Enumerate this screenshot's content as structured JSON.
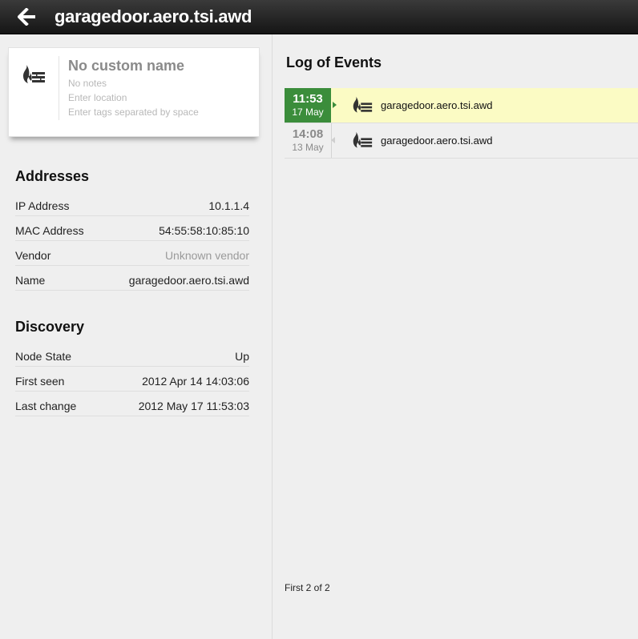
{
  "header": {
    "title": "garagedoor.aero.tsi.awd",
    "back_icon": "arrow-left-icon"
  },
  "node_card": {
    "icon": "firewall-icon",
    "name": "No custom name",
    "notes": "No notes",
    "location": "Enter location",
    "tags": "Enter tags separated by space"
  },
  "addresses": {
    "title": "Addresses",
    "rows": [
      {
        "label": "IP Address",
        "value": "10.1.1.4"
      },
      {
        "label": "MAC Address",
        "value": "54:55:58:10:85:10"
      },
      {
        "label": "Vendor",
        "value": "Unknown vendor"
      },
      {
        "label": "Name",
        "value": "garagedoor.aero.tsi.awd"
      }
    ]
  },
  "discovery": {
    "title": "Discovery",
    "rows": [
      {
        "label": "Node State",
        "value": "Up"
      },
      {
        "label": "First seen",
        "value": "2012 Apr 14 14:03:06"
      },
      {
        "label": "Last change",
        "value": "2012 May 17 11:53:03"
      }
    ]
  },
  "log": {
    "title": "Log of Events",
    "events": [
      {
        "time": "11:53",
        "date": "17 May",
        "text": "garagedoor.aero.tsi.awd",
        "icon": "firewall-icon",
        "highlighted": true
      },
      {
        "time": "14:08",
        "date": "13 May",
        "text": "garagedoor.aero.tsi.awd",
        "icon": "firewall-icon",
        "highlighted": false
      }
    ],
    "pager": "First 2 of 2"
  },
  "colors": {
    "header_bg": "#1c1c1c",
    "active_event_bg": "#fbfbc4",
    "active_time_bg": "#3b8d3b",
    "panel_bg": "#efefef"
  }
}
